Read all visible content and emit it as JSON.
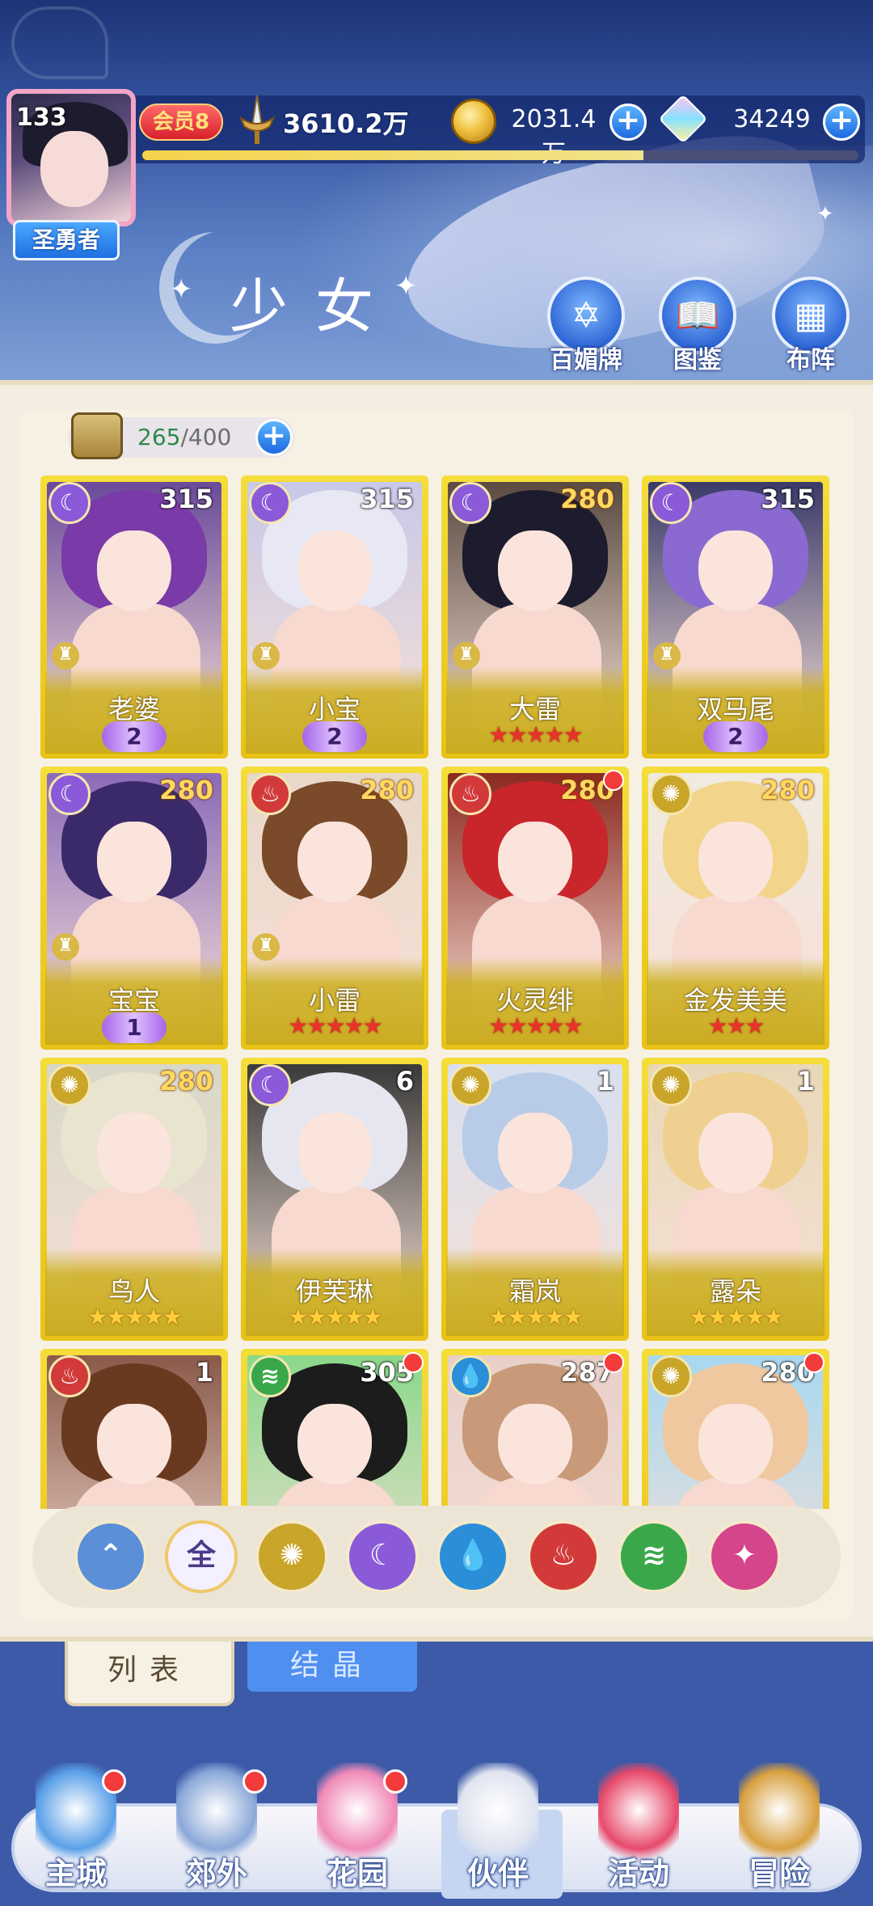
{
  "header": {
    "level": "133",
    "title_badge": "圣勇者",
    "vip": "会员8",
    "power": "3610.2万",
    "gold": "2031.4万",
    "gems": "34249",
    "exp_progress": 0.7,
    "page_title": "少女",
    "actions": [
      {
        "label": "百媚牌",
        "icon": "card-deck-icon"
      },
      {
        "label": "图鉴",
        "icon": "book-icon"
      },
      {
        "label": "布阵",
        "icon": "formation-grid-icon"
      }
    ]
  },
  "capacity": {
    "current": "265",
    "max": "/400"
  },
  "cards": [
    {
      "name": "老婆",
      "level": "315",
      "element": "moon",
      "rank": "wing",
      "wing": "2",
      "level_color": "white",
      "dot": false
    },
    {
      "name": "小宝",
      "level": "315",
      "element": "moon",
      "rank": "wing",
      "wing": "2",
      "level_color": "white",
      "dot": false
    },
    {
      "name": "大雷",
      "level": "280",
      "element": "moon",
      "rank": "stars",
      "stars": 5,
      "star_color": "red",
      "level_color": "orange",
      "dot": false
    },
    {
      "name": "双马尾",
      "level": "315",
      "element": "moon",
      "rank": "wing",
      "wing": "2",
      "level_color": "white",
      "dot": false
    },
    {
      "name": "宝宝",
      "level": "280",
      "element": "moon",
      "rank": "wing",
      "wing": "1",
      "level_color": "orange",
      "dot": false
    },
    {
      "name": "小雷",
      "level": "280",
      "element": "fire",
      "rank": "stars",
      "stars": 5,
      "star_color": "red",
      "level_color": "orange",
      "dot": false
    },
    {
      "name": "火灵绯",
      "level": "280",
      "element": "fire",
      "rank": "stars",
      "stars": 5,
      "star_color": "red",
      "level_color": "orange",
      "dot": true
    },
    {
      "name": "金发美美",
      "level": "280",
      "element": "sun",
      "rank": "stars",
      "stars": 3,
      "star_color": "red",
      "level_color": "orange",
      "dot": false
    },
    {
      "name": "鸟人",
      "level": "280",
      "element": "sun",
      "rank": "stars",
      "stars": 5,
      "star_color": "gold",
      "level_color": "orange",
      "dot": false
    },
    {
      "name": "伊芙琳",
      "level": "6",
      "element": "moon",
      "rank": "stars",
      "stars": 5,
      "star_color": "gold",
      "level_color": "white",
      "dot": false
    },
    {
      "name": "霜岚",
      "level": "1",
      "element": "sun",
      "rank": "stars",
      "stars": 5,
      "star_color": "gold",
      "level_color": "white",
      "dot": false
    },
    {
      "name": "露朵",
      "level": "1",
      "element": "sun",
      "rank": "stars",
      "stars": 5,
      "star_color": "gold",
      "level_color": "white",
      "dot": false
    },
    {
      "name": "",
      "level": "1",
      "element": "fire",
      "rank": "none",
      "level_color": "white",
      "dot": false
    },
    {
      "name": "",
      "level": "305",
      "element": "wind",
      "rank": "none",
      "level_color": "white",
      "dot": true
    },
    {
      "name": "",
      "level": "287",
      "element": "water",
      "rank": "none",
      "level_color": "white",
      "dot": true
    },
    {
      "name": "",
      "level": "280",
      "element": "sun",
      "rank": "none",
      "level_color": "white",
      "dot": true
    }
  ],
  "filters": [
    {
      "name": "filter-sort",
      "glyph": "⌃",
      "color": "#5b8fd8"
    },
    {
      "name": "filter-all",
      "glyph": "全",
      "color": "#f4f0ff"
    },
    {
      "name": "filter-sun",
      "glyph": "✺",
      "color": "#c9a52a"
    },
    {
      "name": "filter-moon",
      "glyph": "☾",
      "color": "#8a5ad8"
    },
    {
      "name": "filter-water",
      "glyph": "💧",
      "color": "#2b8ed8"
    },
    {
      "name": "filter-fire",
      "glyph": "♨",
      "color": "#d23a3a"
    },
    {
      "name": "filter-wind",
      "glyph": "≋",
      "color": "#3aa84a"
    },
    {
      "name": "filter-star",
      "glyph": "✦",
      "color": "#d4458c"
    }
  ],
  "tabs": {
    "list": "列表",
    "crystal": "结晶"
  },
  "nav": [
    {
      "label": "主城",
      "dot": true
    },
    {
      "label": "郊外",
      "dot": true
    },
    {
      "label": "花园",
      "dot": true
    },
    {
      "label": "伙伴",
      "dot": false,
      "selected": true
    },
    {
      "label": "活动",
      "dot": false
    },
    {
      "label": "冒险",
      "dot": false
    }
  ]
}
